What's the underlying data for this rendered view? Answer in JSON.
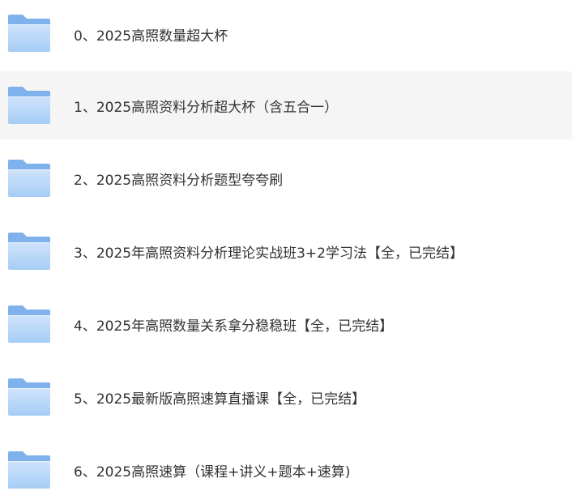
{
  "colors": {
    "folder_back": "#7fb2ec",
    "folder_front_top": "#cfe3fb",
    "folder_front_bottom": "#a6cdf6",
    "row_selected_bg": "#f5f5f6",
    "text": "#333333"
  },
  "folders": [
    {
      "label": "0、2025高照数量超大杯",
      "icon": "folder-icon",
      "selected": false
    },
    {
      "label": "1、2025高照资料分析超大杯（含五合一）",
      "icon": "folder-icon",
      "selected": true
    },
    {
      "label": "2、2025高照资料分析题型夸夸刷",
      "icon": "folder-icon",
      "selected": false
    },
    {
      "label": "3、2025年高照资料分析理论实战班3+2学习法【全，已完结】",
      "icon": "folder-icon",
      "selected": false
    },
    {
      "label": "4、2025年高照数量关系拿分稳稳班【全，已完结】",
      "icon": "folder-icon",
      "selected": false
    },
    {
      "label": "5、2025最新版高照速算直播课【全，已完结】",
      "icon": "folder-icon",
      "selected": false
    },
    {
      "label": "6、2025高照速算（课程+讲义+题本+速算)",
      "icon": "folder-icon",
      "selected": false
    }
  ]
}
